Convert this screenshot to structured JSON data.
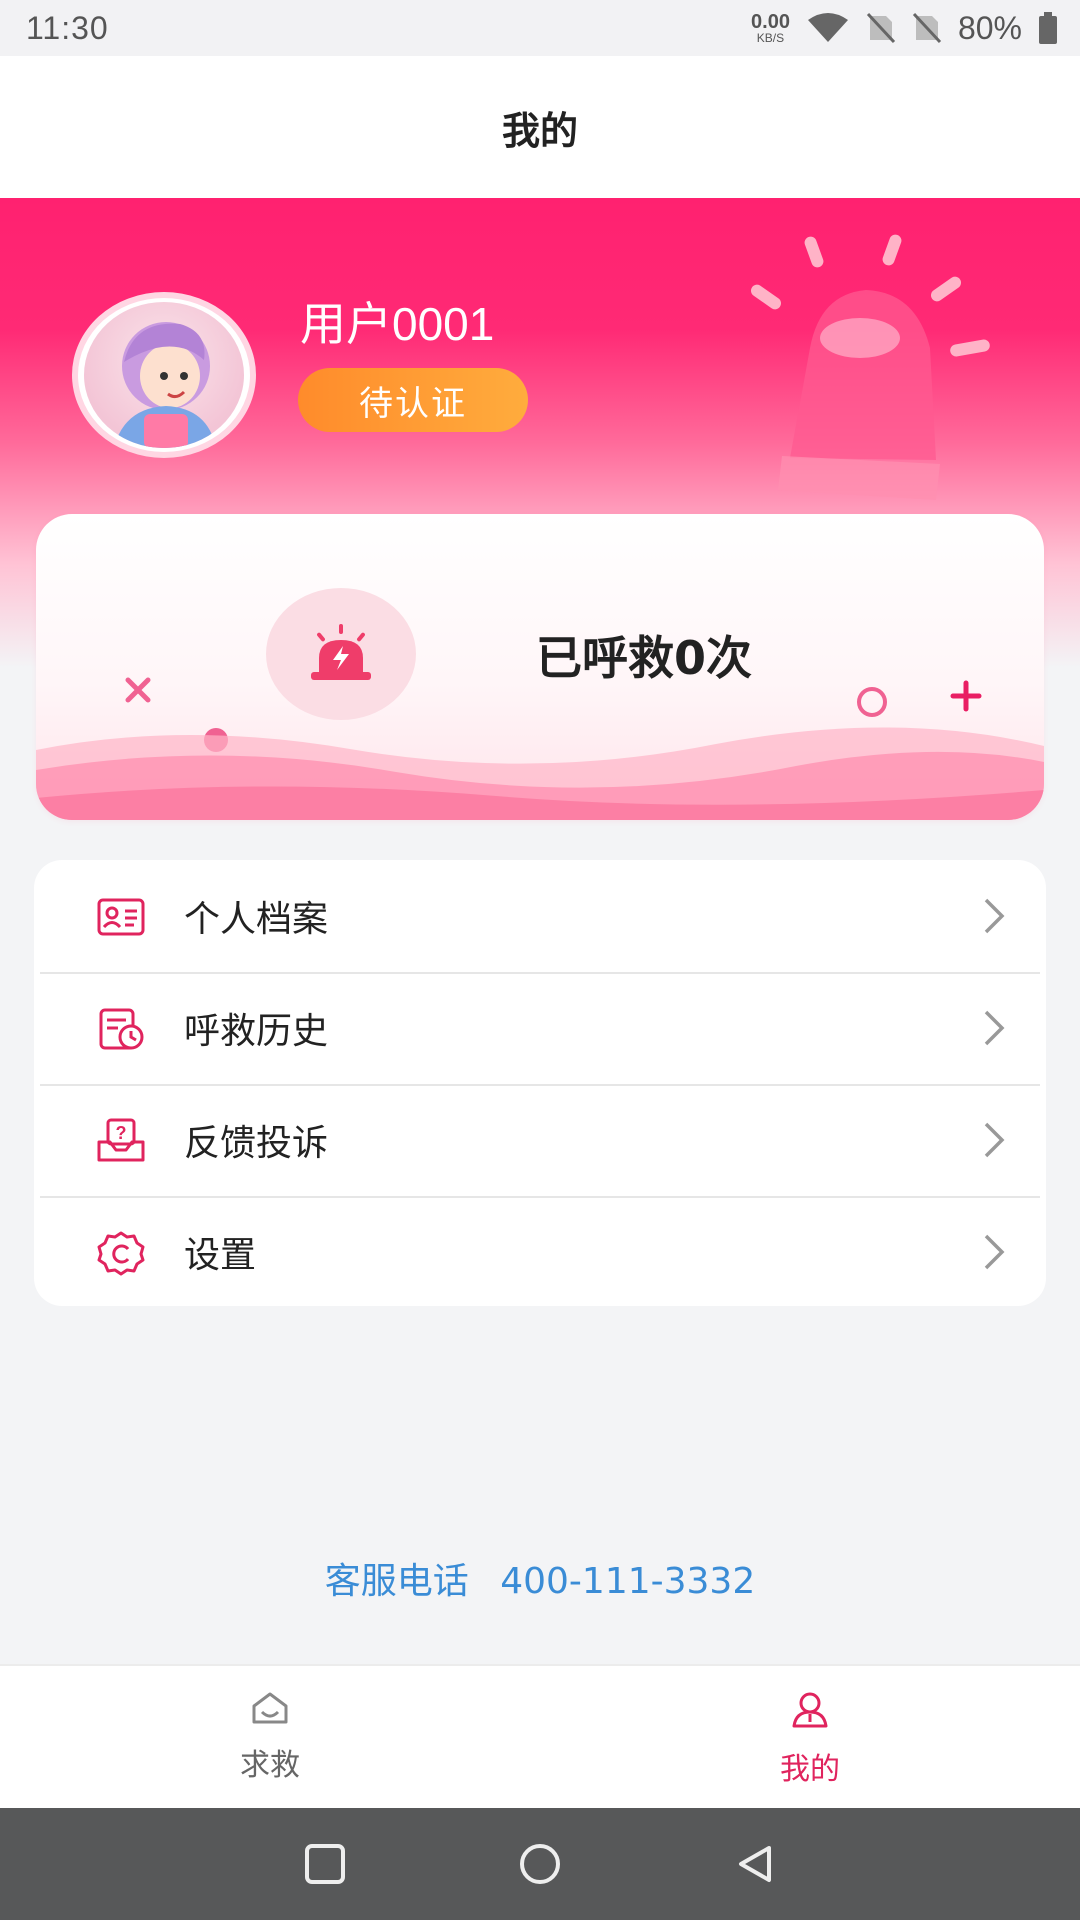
{
  "status_bar": {
    "time": "11:30",
    "net_speed_value": "0.00",
    "net_speed_unit": "KB/S",
    "battery": "80%",
    "icons": [
      "wifi-icon",
      "no-sim-icon",
      "no-sim-icon",
      "battery-icon"
    ]
  },
  "header": {
    "title": "我的"
  },
  "profile": {
    "username": "用户0001",
    "cert_status": "待认证"
  },
  "rescue_card": {
    "count_text": "已呼救0次"
  },
  "menu": {
    "items": [
      {
        "label": "个人档案",
        "icon": "profile-card-icon"
      },
      {
        "label": "呼救历史",
        "icon": "history-clock-icon"
      },
      {
        "label": "反馈投诉",
        "icon": "feedback-inbox-icon"
      },
      {
        "label": "设置",
        "icon": "settings-gear-icon"
      }
    ]
  },
  "service": {
    "label": "客服电话",
    "phone": "400-111-3332"
  },
  "tabs": [
    {
      "label": "求救",
      "icon": "home-icon",
      "active": false
    },
    {
      "label": "我的",
      "icon": "person-icon",
      "active": true
    }
  ],
  "colors": {
    "brand_pink": "#ff2170",
    "badge_orange": "#ff9a33",
    "link_blue": "#3a8cd6",
    "active_tab": "#e0245e"
  }
}
